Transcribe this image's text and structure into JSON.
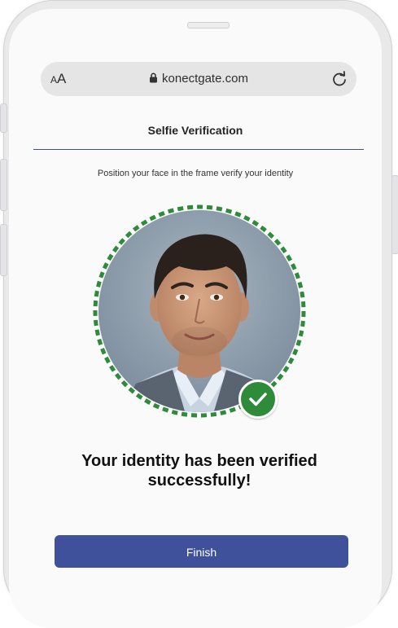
{
  "browser": {
    "text_size_label": "AA",
    "url": "konectgate.com"
  },
  "page": {
    "title": "Selfie Verification",
    "instruction": "Position your face in the frame verify your identity",
    "success_line_1": "Your identity has been verified",
    "success_line_2": "successfully!",
    "finish_label": "Finish"
  },
  "colors": {
    "accent": "#3f519b",
    "success": "#2e8b3a",
    "frame_ring": "#2e8b3a"
  },
  "icons": {
    "lock": "lock-icon",
    "reload": "reload-icon",
    "check": "checkmark-icon"
  },
  "status": {
    "verified": true
  }
}
